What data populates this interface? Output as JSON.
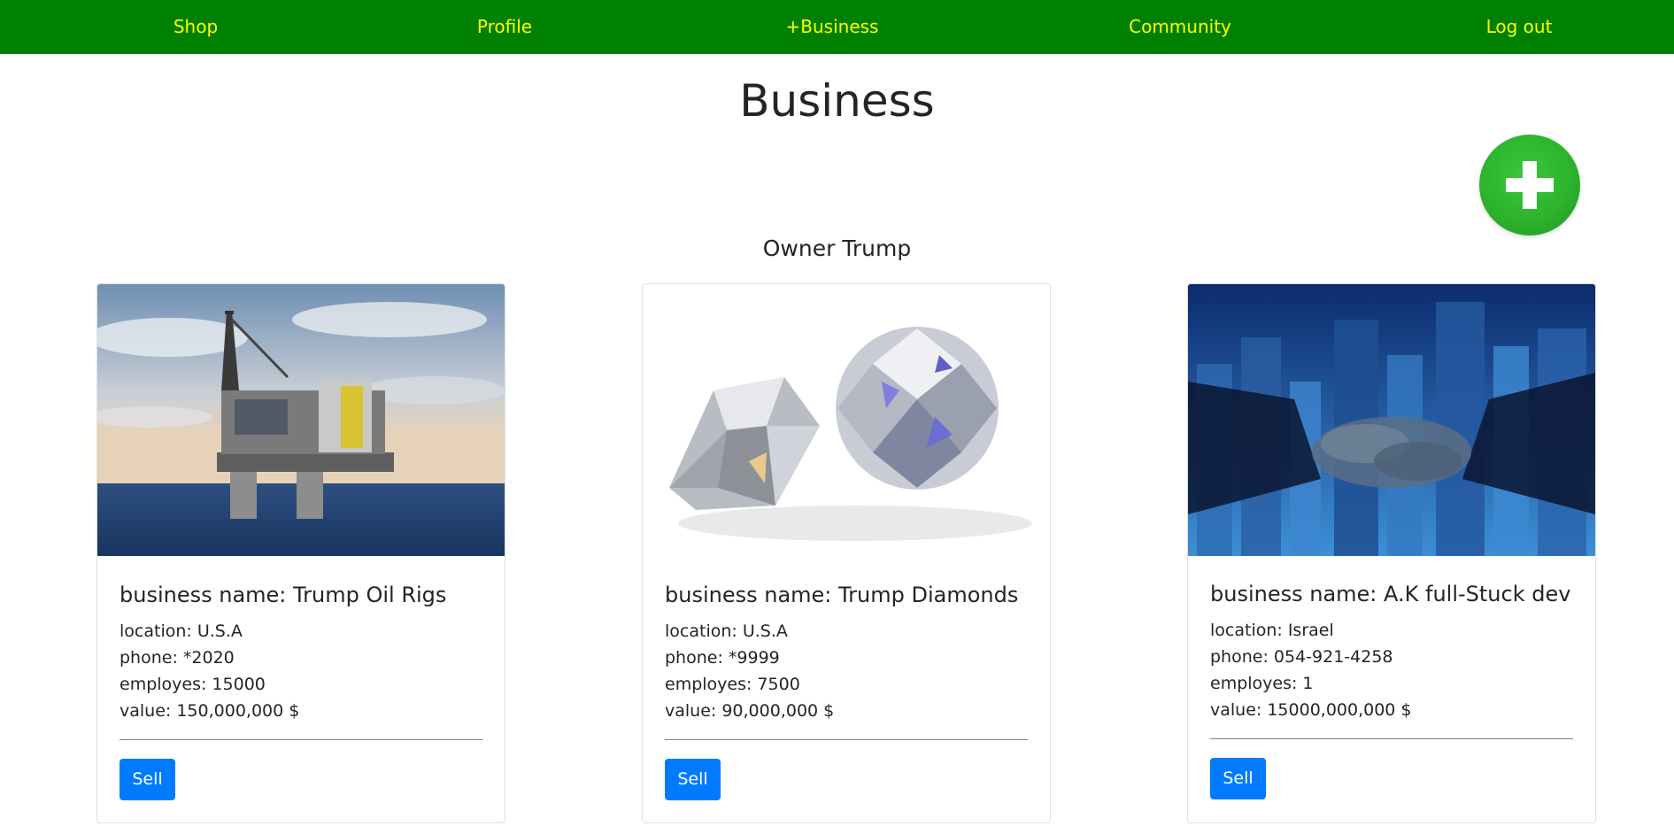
{
  "nav": {
    "shop": "Shop",
    "profile": "Profile",
    "business": "+Business",
    "community": "Community",
    "logout": "Log out"
  },
  "page": {
    "title": "Business",
    "owner_heading": "Owner Trump"
  },
  "colors": {
    "navbar": "#008000",
    "nav_text": "#ffff00",
    "add_button": "#2db32d",
    "sell_button": "#007bff"
  },
  "icons": {
    "add": "plus-icon"
  },
  "businesses": [
    {
      "image": "oil-rig-image",
      "name": "business name: Trump Oil Rigs",
      "location": "location: U.S.A",
      "phone": "phone: *2020",
      "employees": "employes: 15000",
      "value": "value: 150,000,000 $",
      "sell_label": "Sell"
    },
    {
      "image": "diamonds-image",
      "name": "business name: Trump Diamonds",
      "location": "location: U.S.A",
      "phone": "phone: *9999",
      "employees": "employes: 7500",
      "value": "value: 90,000,000 $",
      "sell_label": "Sell"
    },
    {
      "image": "handshake-city-image",
      "name": "business name: A.K full-Stuck dev",
      "location": "location: Israel",
      "phone": "phone: 054-921-4258",
      "employees": "employes: 1",
      "value": "value: 15000,000,000 $",
      "sell_label": "Sell"
    }
  ]
}
